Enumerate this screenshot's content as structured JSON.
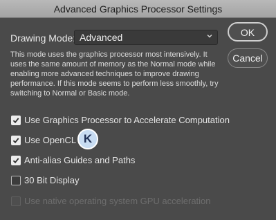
{
  "window": {
    "title": "Advanced Graphics Processor Settings"
  },
  "drawing_mode": {
    "label": "Drawing Mode:",
    "value": "Advanced",
    "description": "This mode uses the graphics processor most intensively.  It uses the same amount of memory as the Normal mode while enabling more advanced techniques to improve drawing performance.  If this mode seems to perform less smoothly, try switching to Normal or Basic mode."
  },
  "buttons": {
    "ok": "OK",
    "cancel": "Cancel"
  },
  "options": [
    {
      "label": "Use Graphics Processor to Accelerate Computation",
      "checked": true,
      "enabled": true
    },
    {
      "label": "Use OpenCL",
      "checked": true,
      "enabled": true
    },
    {
      "label": "Anti-alias Guides and Paths",
      "checked": true,
      "enabled": true
    },
    {
      "label": "30 Bit Display",
      "checked": false,
      "enabled": true
    },
    {
      "label": "Use native operating system GPU acceleration",
      "checked": false,
      "enabled": false
    }
  ],
  "badge": {
    "letter": "K"
  }
}
